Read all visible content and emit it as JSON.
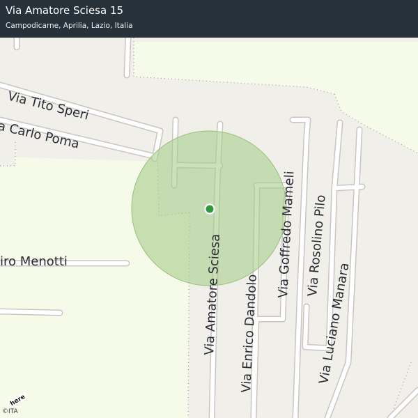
{
  "header": {
    "title": "Via Amatore Sciesa 15",
    "subtitle": "Campodicarne, Aprilia, Lazio, Italia"
  },
  "map": {
    "street_labels": [
      "Via Tito Speri",
      "a Carlo Poma",
      "iro Menotti",
      "Via Amatore Sciesa",
      "Via Enrico Dandolo",
      "Via Goffredo Mameli",
      "Via Rosolino Pilo",
      "Via Luciano Manara"
    ],
    "colors": {
      "background": "#f6fbe9",
      "area": "#f1efea",
      "road_fill": "#ffffff",
      "road_casing": "#c9c6c2",
      "accuracy_circle": "#a8cd8a",
      "location_dot": "#2f9a3a",
      "header": "#26313a"
    },
    "location_marker": "location-dot-icon"
  },
  "footer": {
    "logo": "here",
    "copyright": "©ITA"
  }
}
